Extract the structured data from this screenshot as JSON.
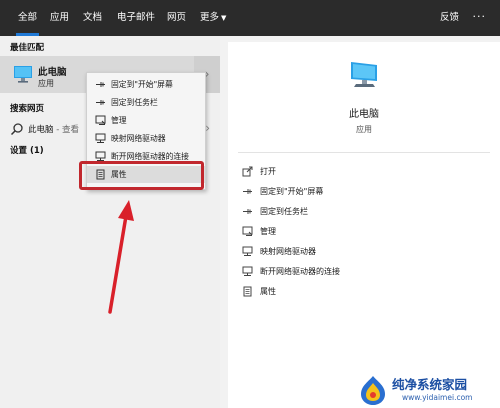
{
  "tabs": [
    {
      "label": "全部",
      "active": true
    },
    {
      "label": "应用",
      "active": false
    },
    {
      "label": "文档",
      "active": false
    },
    {
      "label": "电子邮件",
      "active": false
    },
    {
      "label": "网页",
      "active": false
    },
    {
      "label": "更多",
      "active": false
    }
  ],
  "feedback_label": "反馈",
  "more_dots": "···",
  "left_panel": {
    "best_match_header": "最佳匹配",
    "best_match": {
      "title": "此电脑",
      "subtitle": "应用"
    },
    "search_web_header": "搜索网页",
    "web_result": {
      "text": "此电脑",
      "suffix": " - 查看"
    },
    "settings_header": "设置 (1)"
  },
  "context_menu": [
    {
      "label": "固定到\"开始\"屏幕",
      "icon": "pin-icon"
    },
    {
      "label": "固定到任务栏",
      "icon": "pin-icon"
    },
    {
      "label": "管理",
      "icon": "manage-icon"
    },
    {
      "label": "映射网络驱动器",
      "icon": "network-drive-icon"
    },
    {
      "label": "断开网络驱动器的连接",
      "icon": "network-drive-icon"
    },
    {
      "label": "属性",
      "icon": "properties-icon",
      "selected": true
    }
  ],
  "preview": {
    "title": "此电脑",
    "subtitle": "应用",
    "actions": [
      {
        "label": "打开",
        "icon": "open-icon"
      },
      {
        "label": "固定到\"开始\"屏幕",
        "icon": "pin-icon"
      },
      {
        "label": "固定到任务栏",
        "icon": "pin-icon"
      },
      {
        "label": "管理",
        "icon": "manage-icon"
      },
      {
        "label": "映射网络驱动器",
        "icon": "network-drive-icon"
      },
      {
        "label": "断开网络驱动器的连接",
        "icon": "network-drive-icon"
      },
      {
        "label": "属性",
        "icon": "properties-icon"
      }
    ]
  },
  "watermark": {
    "title": "纯净系统家园",
    "url": "www.yidaimei.com"
  },
  "colors": {
    "topbar": "#2b2b2b",
    "accent": "#1f79d6",
    "highlight": "#c1272d"
  }
}
